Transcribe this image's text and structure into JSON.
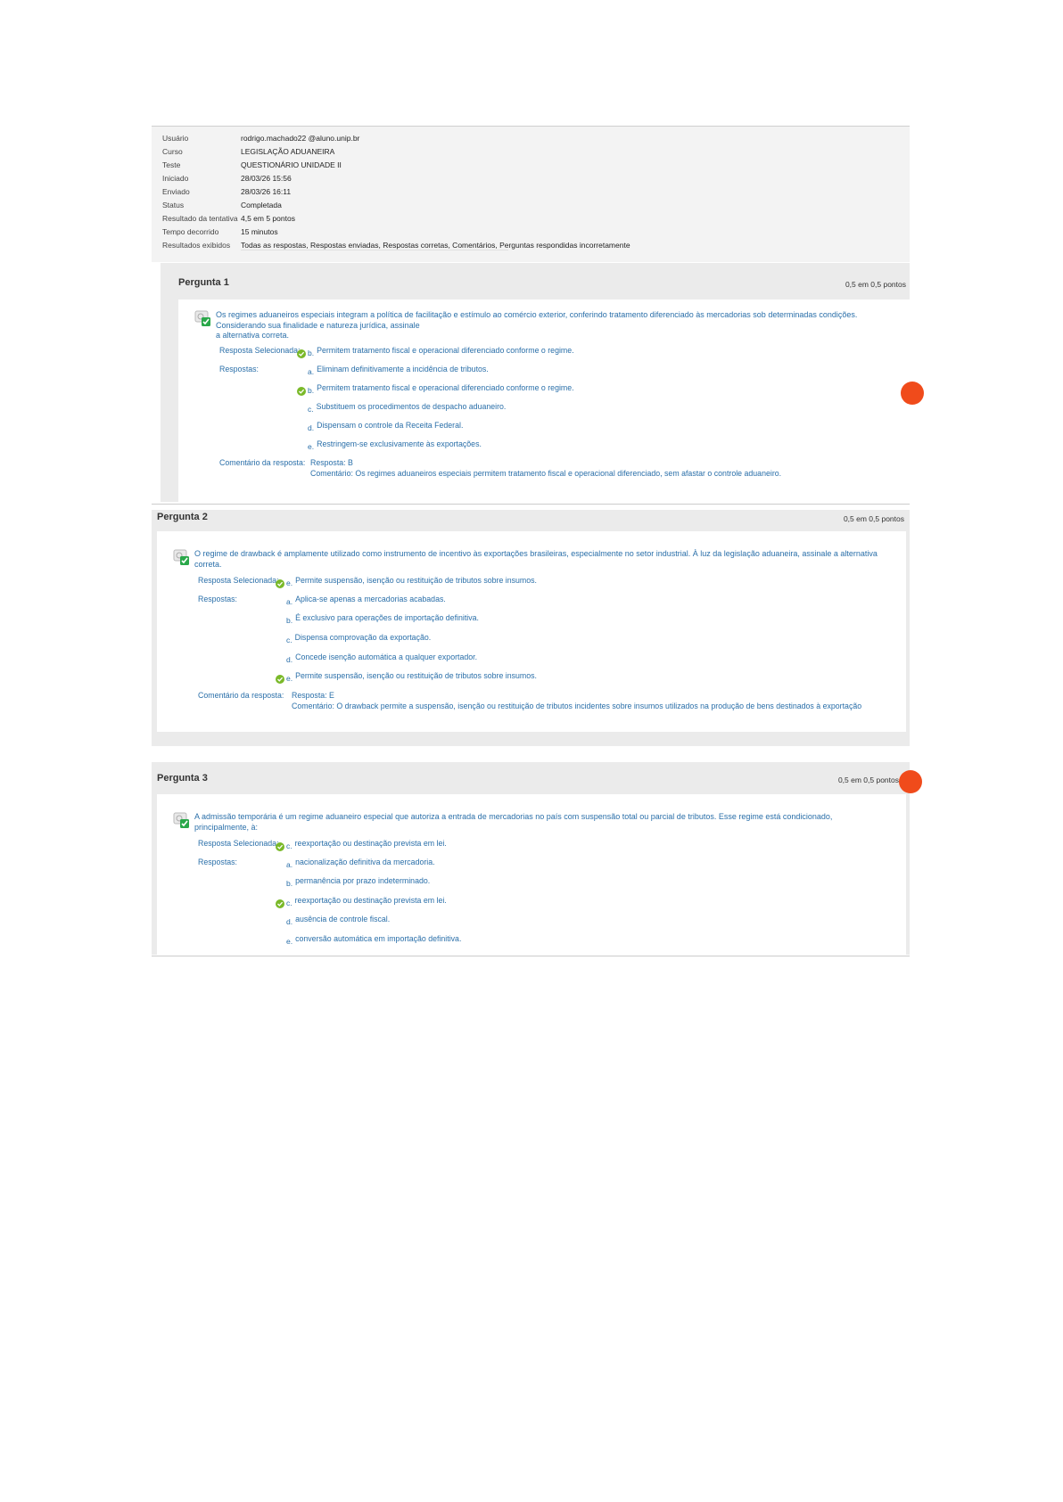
{
  "summary": {
    "rows": [
      {
        "label": "Usuário",
        "value": "rodrigo.machado22 @aluno.unip.br"
      },
      {
        "label": "Curso",
        "value": "LEGISLAÇÃO ADUANEIRA"
      },
      {
        "label": "Teste",
        "value": "QUESTIONÁRIO UNIDADE II"
      },
      {
        "label": "Iniciado",
        "value": "28/03/26 15:56"
      },
      {
        "label": "Enviado",
        "value": "28/03/26 16:11"
      },
      {
        "label": "Status",
        "value": "Completada"
      },
      {
        "label": "Resultado da tentativa",
        "value": "4,5 em 5 pontos"
      },
      {
        "label": "Tempo decorrido",
        "value": "15 minutos"
      },
      {
        "label": "Resultados exibidos",
        "value": "Todas as respostas, Respostas enviadas, Respostas corretas, Comentários, Perguntas respondidas incorretamente"
      }
    ]
  },
  "labels": {
    "selected": "Resposta Selecionada:",
    "answers": "Respostas:",
    "comment": "Comentário da resposta:"
  },
  "questions": [
    {
      "title": "Pergunta 1",
      "points": "0,5 em 0,5 pontos",
      "text_lines": [
        "Os regimes aduaneiros especiais integram a política de facilitação e estímulo ao comércio exterior, conferindo tratamento diferenciado às mercadorias sob determinadas condições.",
        "Considerando sua finalidade e natureza jurídica, assinale",
        "a alternativa correta."
      ],
      "selected": {
        "letter": "b.",
        "text": "Permitem tratamento fiscal e operacional diferenciado conforme o regime."
      },
      "options": [
        {
          "letter": "a.",
          "text": "Eliminam definitivamente a incidência de tributos.",
          "correct": false
        },
        {
          "letter": "b.",
          "text": "Permitem tratamento fiscal e operacional diferenciado conforme o regime.",
          "correct": true
        },
        {
          "letter": "c.",
          "text": "Substituem os procedimentos de despacho aduaneiro.",
          "correct": false
        },
        {
          "letter": "d.",
          "text": "Dispensam o controle da Receita Federal.",
          "correct": false
        },
        {
          "letter": "e.",
          "text": "Restringem-se exclusivamente às exportações.",
          "correct": false
        }
      ],
      "comment_answer": "Resposta: B",
      "comment_text": "Comentário: Os regimes aduaneiros especiais permitem tratamento fiscal e operacional diferenciado, sem afastar o controle aduaneiro."
    },
    {
      "title": "Pergunta 2",
      "points": "0,5 em 0,5 pontos",
      "text_lines": [
        "O regime de drawback é amplamente utilizado como instrumento de incentivo às exportações brasileiras, especialmente no setor industrial. À luz da legislação aduaneira, assinale a alternativa",
        "correta."
      ],
      "selected": {
        "letter": "e.",
        "text": "Permite suspensão, isenção ou restituição de tributos sobre insumos."
      },
      "options": [
        {
          "letter": "a.",
          "text": "Aplica-se apenas a mercadorias acabadas.",
          "correct": false
        },
        {
          "letter": "b.",
          "text": "É exclusivo para operações de importação definitiva.",
          "correct": false
        },
        {
          "letter": "c.",
          "text": "Dispensa comprovação da exportação.",
          "correct": false
        },
        {
          "letter": "d.",
          "text": "Concede isenção automática a qualquer exportador.",
          "correct": false
        },
        {
          "letter": "e.",
          "text": "Permite suspensão, isenção ou restituição de tributos sobre insumos.",
          "correct": true
        }
      ],
      "comment_answer": "Resposta: E",
      "comment_text": "Comentário: O drawback permite a suspensão, isenção ou restituição de tributos incidentes sobre insumos utilizados na produção de bens destinados à exportação"
    },
    {
      "title": "Pergunta 3",
      "points": "0,5 em 0,5 pontos",
      "text_lines": [
        "A admissão temporária é um regime aduaneiro especial que autoriza a entrada de mercadorias no país com suspensão total ou parcial de tributos. Esse regime está condicionado,",
        "principalmente, à:"
      ],
      "selected": {
        "letter": "c.",
        "text": "reexportação ou destinação prevista em lei."
      },
      "options": [
        {
          "letter": "a.",
          "text": "nacionalização definitiva da mercadoria.",
          "correct": false
        },
        {
          "letter": "b.",
          "text": "permanência por prazo indeterminado.",
          "correct": false
        },
        {
          "letter": "c.",
          "text": "reexportação ou destinação prevista em lei.",
          "correct": true
        },
        {
          "letter": "d.",
          "text": "ausência de controle fiscal.",
          "correct": false
        },
        {
          "letter": "e.",
          "text": "conversão automática em importação definitiva.",
          "correct": false
        }
      ]
    }
  ],
  "colors": {
    "link": "#2a6fa9",
    "check": "#7ab929",
    "accent": "#f04b1b"
  },
  "icons": [
    "question-correct-icon",
    "check-circle-icon",
    "feedback-bubble-icon"
  ]
}
